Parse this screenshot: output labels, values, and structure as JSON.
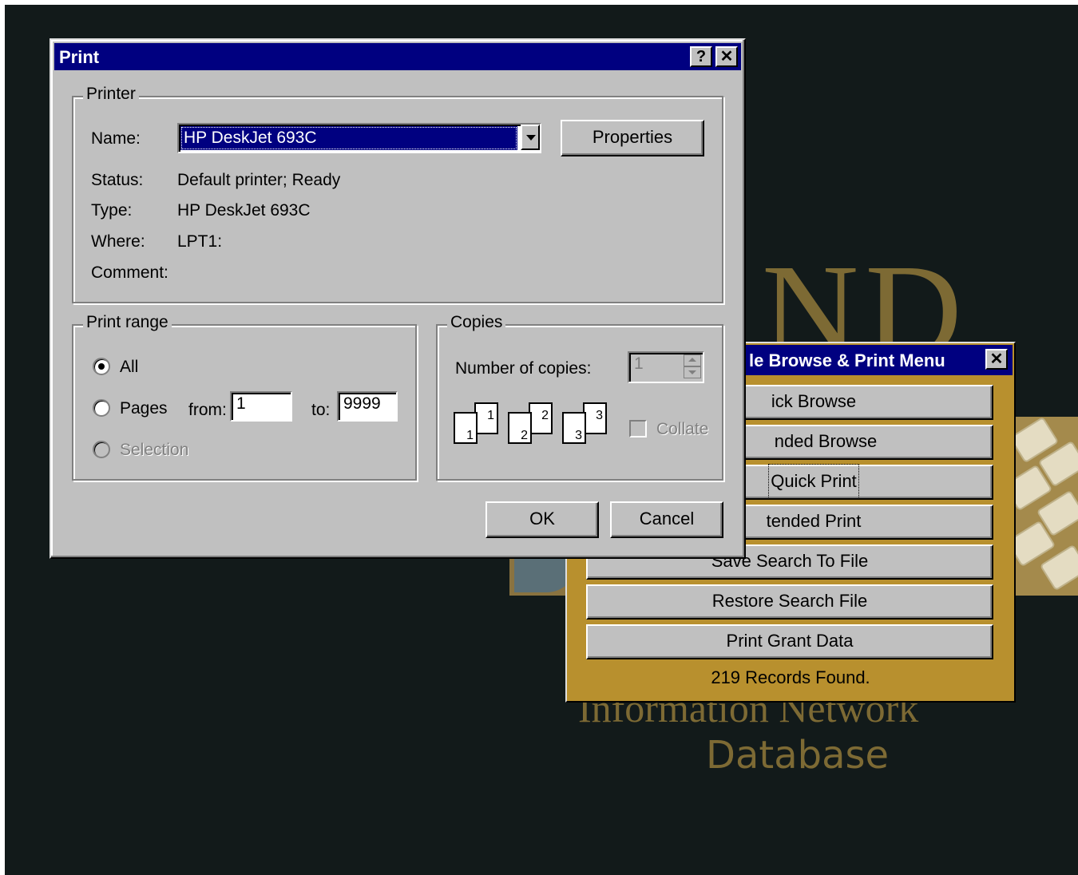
{
  "background": {
    "logo_letters": "ND",
    "info_line": "Information Network",
    "database_line": "Database"
  },
  "print_dialog": {
    "title": "Print",
    "help_label": "?",
    "close_label": "✕",
    "printer_group": {
      "title": "Printer",
      "name_label": "Name:",
      "name_value": "HP DeskJet 693C",
      "properties_label": "Properties",
      "status_label": "Status:",
      "status_value": "Default printer; Ready",
      "type_label": "Type:",
      "type_value": "HP DeskJet 693C",
      "where_label": "Where:",
      "where_value": "LPT1:",
      "comment_label": "Comment:",
      "comment_value": ""
    },
    "range_group": {
      "title": "Print range",
      "all_label": "All",
      "pages_label": "Pages",
      "from_label": "from:",
      "from_value": "1",
      "to_label": "to:",
      "to_value": "9999",
      "selection_label": "Selection",
      "selected": "All"
    },
    "copies_group": {
      "title": "Copies",
      "copies_label": "Number of copies:",
      "copies_value": "1",
      "collate_label": "Collate",
      "collate_checked": false,
      "pages": [
        "1",
        "2",
        "3"
      ]
    },
    "ok_label": "OK",
    "cancel_label": "Cancel"
  },
  "menu_panel": {
    "title": "le Browse & Print Menu",
    "close_label": "✕",
    "items": [
      "ick Browse",
      "nded Browse",
      "Quick Print",
      "tended Print",
      "Save Search To File",
      "Restore Search File",
      "Print Grant Data"
    ],
    "status": "219 Records Found."
  },
  "colors": {
    "desktop": "#121a1a",
    "title_bar": "#000080",
    "panel_gold": "#b8902e",
    "logo_gold": "#7d6a34"
  }
}
